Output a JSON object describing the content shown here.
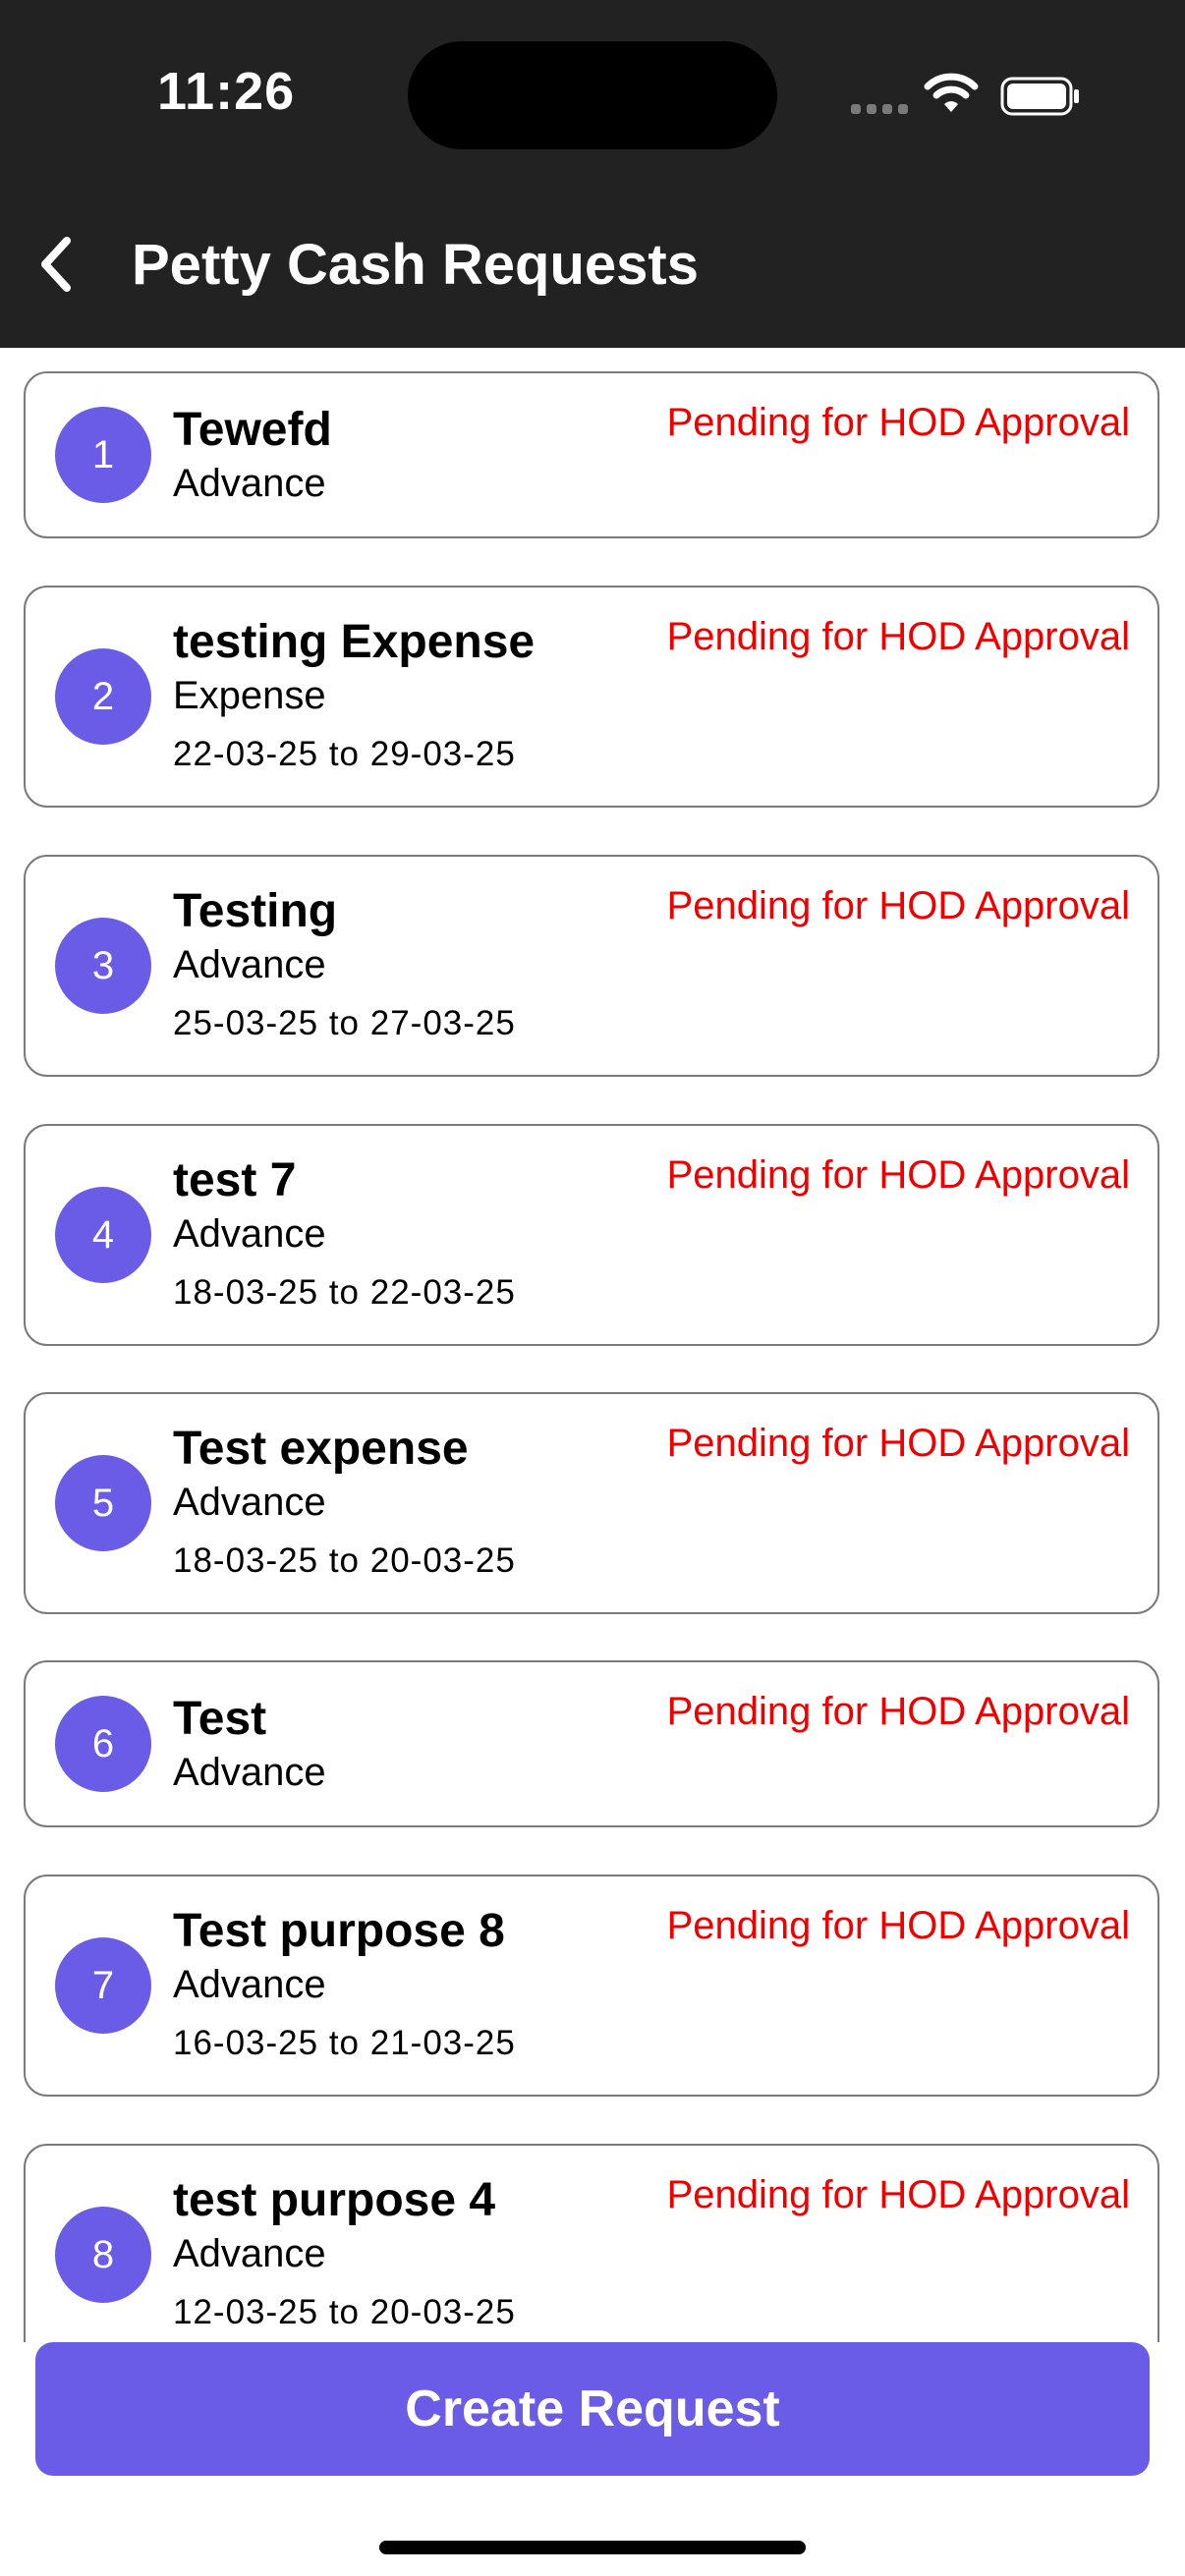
{
  "status_bar": {
    "time": "11:26"
  },
  "header": {
    "title": "Petty Cash Requests",
    "back_icon": "chevron-left-icon"
  },
  "colors": {
    "header_bg": "#222222",
    "accent": "#6b5ce7",
    "status_pending": "#ef0000"
  },
  "requests": [
    {
      "index": "1",
      "title": "Tewefd",
      "type": "Advance",
      "dates": "",
      "status": "Pending for HOD Approval"
    },
    {
      "index": "2",
      "title": "testing Expense",
      "type": "Expense",
      "dates": "22-03-25 to 29-03-25",
      "status": "Pending for HOD Approval"
    },
    {
      "index": "3",
      "title": "Testing",
      "type": "Advance",
      "dates": "25-03-25 to 27-03-25",
      "status": "Pending for HOD Approval"
    },
    {
      "index": "4",
      "title": "test 7",
      "type": "Advance",
      "dates": "18-03-25 to 22-03-25",
      "status": "Pending for HOD Approval"
    },
    {
      "index": "5",
      "title": "Test expense",
      "type": "Advance",
      "dates": "18-03-25 to 20-03-25",
      "status": "Pending for HOD Approval"
    },
    {
      "index": "6",
      "title": "Test",
      "type": "Advance",
      "dates": "",
      "status": "Pending for HOD Approval"
    },
    {
      "index": "7",
      "title": "Test purpose 8",
      "type": "Advance",
      "dates": "16-03-25 to 21-03-25",
      "status": "Pending for HOD Approval"
    },
    {
      "index": "8",
      "title": "test purpose 4",
      "type": "Advance",
      "dates": "12-03-25 to 20-03-25",
      "status": "Pending for HOD Approval"
    }
  ],
  "footer": {
    "create_label": "Create Request"
  }
}
